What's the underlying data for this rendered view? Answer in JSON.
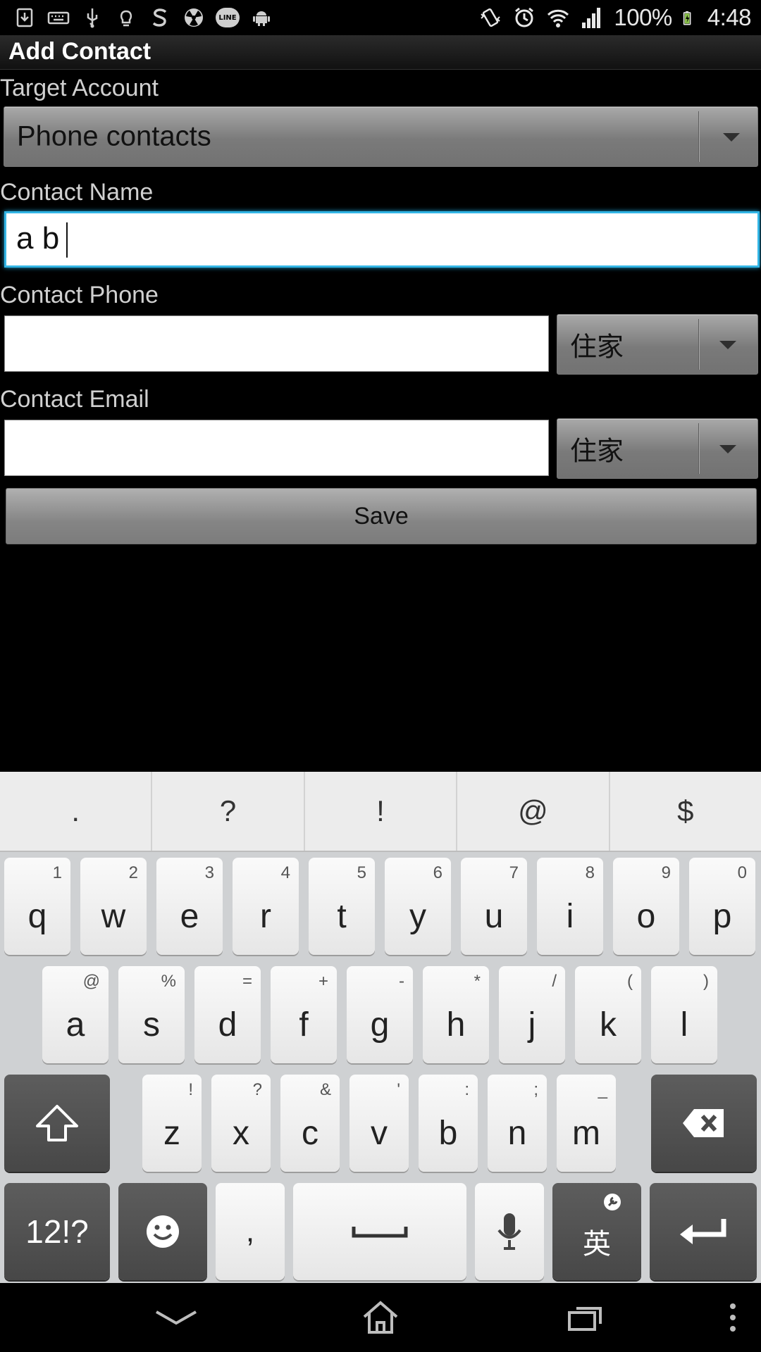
{
  "status_bar": {
    "left_icons": [
      "download-icon",
      "keyboard-icon",
      "usb-icon",
      "lightbulb-icon",
      "s-app-icon",
      "radiation-icon",
      "line-app-icon",
      "android-icon"
    ],
    "line_badge": "LINE",
    "battery": "100%",
    "time": "4:48"
  },
  "app_bar": {
    "title": "Add Contact"
  },
  "form": {
    "target_account_label": "Target Account",
    "target_account_value": "Phone contacts",
    "contact_name_label": "Contact Name",
    "contact_name_value": "a b",
    "contact_phone_label": "Contact Phone",
    "contact_phone_value": "",
    "contact_phone_type": "住家",
    "contact_email_label": "Contact Email",
    "contact_email_value": "",
    "contact_email_type": "住家",
    "save_label": "Save"
  },
  "keyboard": {
    "suggestions": [
      ".",
      "?",
      "!",
      "@",
      "$"
    ],
    "row1": [
      {
        "key": "q",
        "hint": "1"
      },
      {
        "key": "w",
        "hint": "2"
      },
      {
        "key": "e",
        "hint": "3"
      },
      {
        "key": "r",
        "hint": "4"
      },
      {
        "key": "t",
        "hint": "5"
      },
      {
        "key": "y",
        "hint": "6"
      },
      {
        "key": "u",
        "hint": "7"
      },
      {
        "key": "i",
        "hint": "8"
      },
      {
        "key": "o",
        "hint": "9"
      },
      {
        "key": "p",
        "hint": "0"
      }
    ],
    "row2": [
      {
        "key": "a",
        "hint": "@"
      },
      {
        "key": "s",
        "hint": "%"
      },
      {
        "key": "d",
        "hint": "="
      },
      {
        "key": "f",
        "hint": "+"
      },
      {
        "key": "g",
        "hint": "-"
      },
      {
        "key": "h",
        "hint": "*"
      },
      {
        "key": "j",
        "hint": "/"
      },
      {
        "key": "k",
        "hint": "("
      },
      {
        "key": "l",
        "hint": ")"
      }
    ],
    "row3": [
      {
        "key": "z",
        "hint": "!"
      },
      {
        "key": "x",
        "hint": "?"
      },
      {
        "key": "c",
        "hint": "&"
      },
      {
        "key": "v",
        "hint": "'"
      },
      {
        "key": "b",
        "hint": ":"
      },
      {
        "key": "n",
        "hint": ";"
      },
      {
        "key": "m",
        "hint": "_"
      }
    ],
    "symbols_key": "12!?",
    "comma_key": ",",
    "lang_key": "英"
  }
}
